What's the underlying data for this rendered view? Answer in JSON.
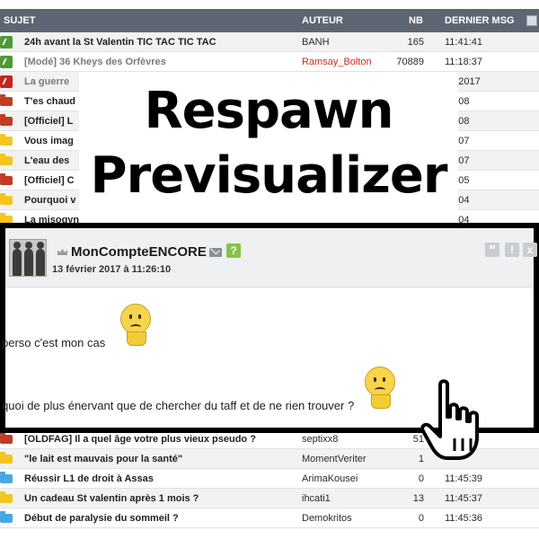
{
  "table": {
    "headers": {
      "sujet": "SUJET",
      "auteur": "AUTEUR",
      "nb": "NB",
      "dernier": "DERNIER MSG"
    },
    "rows_top": [
      {
        "icon": "pin-green-icon",
        "title": "24h avant la St Valentin TIC TAC TIC TAC",
        "author": "BANH",
        "nb": "165",
        "last": "11:41:41"
      },
      {
        "icon": "pin-green-icon",
        "title": "[Modé] 36 Kheys des Orfèvres",
        "author": "Ramsay_Bolton",
        "nb": "70889",
        "last": "11:18:37"
      },
      {
        "icon": "pin-red-icon",
        "title": "La guerre",
        "author": "",
        "nb": "",
        "last": "02/2017"
      },
      {
        "icon": "folder-red-icon",
        "title": "T'es chaud",
        "author": "",
        "nb": "",
        "last": "46:08"
      },
      {
        "icon": "folder-red-icon",
        "title": "[Officiel] L",
        "author": "",
        "nb": "",
        "last": "46:08"
      },
      {
        "icon": "folder-yellow-icon",
        "title": "Vous imag",
        "author": "",
        "nb": "",
        "last": "46:07"
      },
      {
        "icon": "folder-yellow-icon",
        "title": "L'eau des",
        "author": "",
        "nb": "",
        "last": "46:07"
      },
      {
        "icon": "folder-red-icon",
        "title": "[Officiel] C",
        "author": "",
        "nb": "",
        "last": "46:05"
      },
      {
        "icon": "folder-yellow-icon",
        "title": "Pourquoi v",
        "author": "",
        "nb": "",
        "last": "46:04"
      },
      {
        "icon": "folder-yellow-icon",
        "title": "La misogynie, le truc qui nous contact demain ?",
        "author": "",
        "nb": "",
        "last": "46:04"
      }
    ],
    "rows_bottom": [
      {
        "icon": "folder-red-icon",
        "title": "[OLDFAG] Il a quel âge votre plus vieux pseudo ?",
        "author": "septixx8",
        "nb": "51",
        "last": ""
      },
      {
        "icon": "folder-yellow-icon",
        "title": "\"le lait est mauvais pour la santé\"",
        "author": "MomentVeriter",
        "nb": "1",
        "last": ""
      },
      {
        "icon": "folder-blue-icon",
        "title": "Réussir L1 de droit à Assas",
        "author": "ArimaKousei",
        "nb": "0",
        "last": "11:45:39"
      },
      {
        "icon": "folder-yellow-icon",
        "title": "Un cadeau St valentin après 1 mois ?",
        "author": "ihcati1",
        "nb": "13",
        "last": "11:45:37"
      },
      {
        "icon": "folder-blue-icon",
        "title": "Début de paralysie du sommeil ?",
        "author": "Demokritos",
        "nb": "0",
        "last": "11:45:36"
      }
    ]
  },
  "overlay": {
    "line1": "Respawn",
    "line2": "Previsualizer"
  },
  "preview": {
    "pseudo": "MonCompteENCORE",
    "date": "13 février 2017 à 11:26:10",
    "help_label": "?",
    "quote_label": "\"",
    "alert_label": "!",
    "close_label": "x",
    "line1": "perso c'est mon cas",
    "line2": "quoi de plus énervant que de chercher du taff et de ne rien trouver ?"
  },
  "colors": {
    "header_bg": "#5e6673",
    "author_red": "#cc2b1d",
    "pin_green": "#4f9a34",
    "folder_yellow": "#f4c51d",
    "folder_blue": "#47a7e6"
  }
}
